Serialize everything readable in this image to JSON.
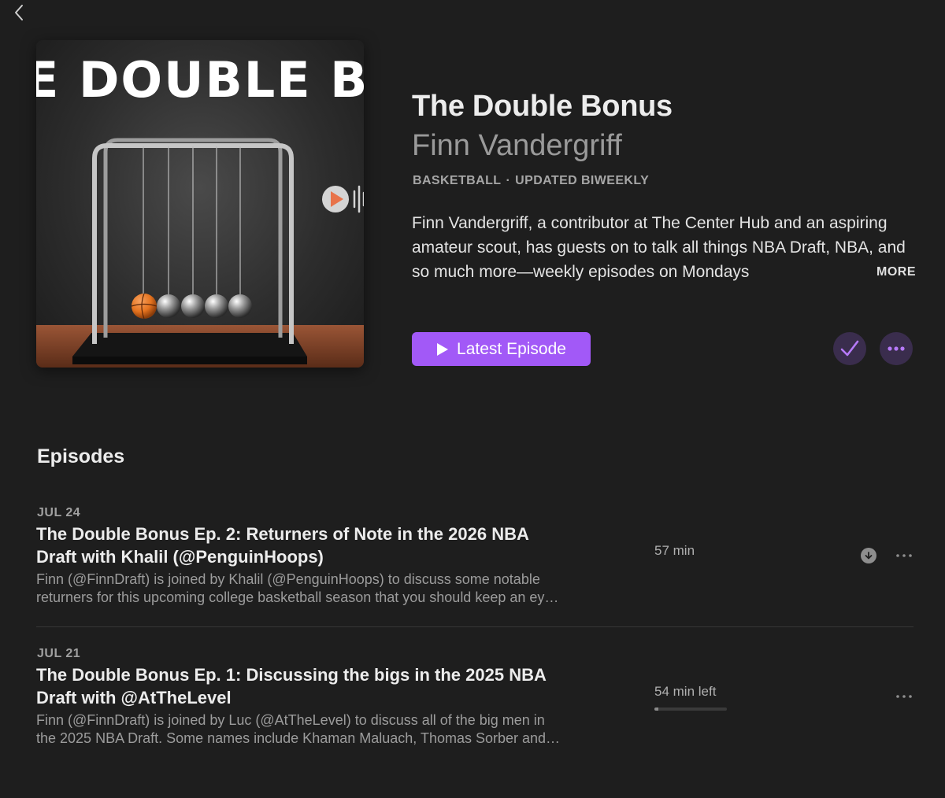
{
  "nav": {
    "back_icon": "chevron-left-icon"
  },
  "artwork": {
    "text": "E DOUBLE BON",
    "play_icon": "play-circle-icon",
    "sound_icon": "audio-wave-icon",
    "colors": {
      "ball": "#e5731f",
      "table": "#8a4a2c",
      "button": "#e8734a"
    }
  },
  "show": {
    "title": "The Double Bonus",
    "author": "Finn Vandergriff",
    "category": "BASKETBALL",
    "meta_separator": "·",
    "frequency": "UPDATED BIWEEKLY",
    "description": "Finn Vandergriff, a contributor at The Center Hub and an aspiring amateur scout, has guests on to talk all things NBA Draft, NBA, and so much more—weekly episodes on Mondays",
    "more_label": "MORE"
  },
  "actions": {
    "latest_label": "Latest Episode",
    "play_icon": "play-icon",
    "check_icon": "checkmark-icon",
    "more_icon": "ellipsis-icon",
    "accent_color": "#a259f7"
  },
  "episodes_heading": "Episodes",
  "episodes": [
    {
      "date": "JUL 24",
      "title": "The Double Bonus Ep. 2: Returners of Note in the 2026 NBA Draft with Khalil (@PenguinHoops)",
      "description": "Finn (@FinnDraft) is joined by Khalil (@PenguinHoops) to discuss some notable returners for this upcoming college basketball season that you should keep an eye on.",
      "duration": "57 min",
      "download_icon": "download-icon",
      "more_icon": "ellipsis-icon"
    },
    {
      "date": "JUL 21",
      "title": "The Double Bonus Ep. 1: Discussing the bigs in the 2025 NBA Draft with @AtTheLevel",
      "description": "Finn (@FinnDraft) is joined by Luc (@AtTheLevel) to discuss all of the big men in the 2025 NBA Draft. Some names include Khaman Maluach, Thomas Sorber and more.",
      "duration": "54 min left",
      "progress": 0.05,
      "more_icon": "ellipsis-icon"
    }
  ]
}
